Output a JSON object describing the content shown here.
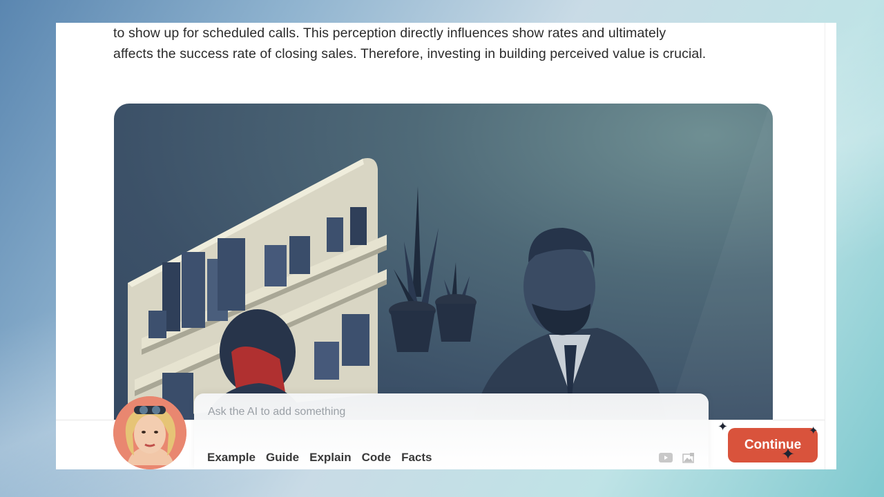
{
  "content": {
    "paragraph_line1": "to show up for scheduled calls. This perception directly influences show rates and ultimately",
    "paragraph_line2": "affects the success rate of closing sales. Therefore, investing in building perceived value is crucial."
  },
  "prompt": {
    "placeholder": "Ask the AI to add something",
    "chips": [
      "Example",
      "Guide",
      "Explain",
      "Code",
      "Facts"
    ]
  },
  "actions": {
    "continue_label": "Continue"
  },
  "icons": [
    "youtube-icon",
    "image-icon",
    "sparkle-icon",
    "cursor-icon"
  ],
  "colors": {
    "accent": "#d9533c",
    "illustration_bg": "#3c5168"
  }
}
